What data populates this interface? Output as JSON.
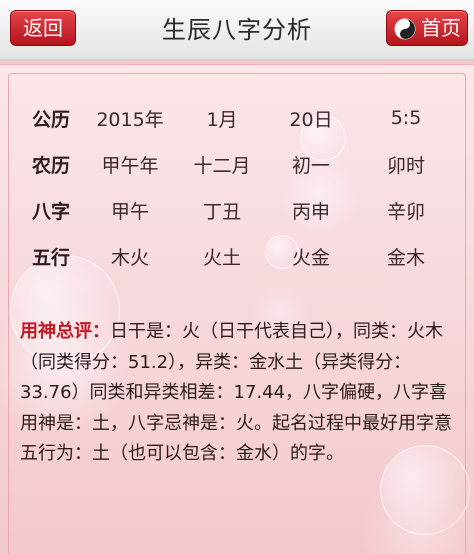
{
  "header": {
    "title": "生辰八字分析",
    "back_label": "返回",
    "home_label": "首页"
  },
  "table": {
    "rows": [
      {
        "head": "公历",
        "cells": [
          "2015年",
          "1月",
          "20日",
          "5:5"
        ]
      },
      {
        "head": "农历",
        "cells": [
          "甲午年",
          "十二月",
          "初一",
          "卯时"
        ]
      },
      {
        "head": "八字",
        "cells": [
          "甲午",
          "丁丑",
          "丙申",
          "辛卯"
        ]
      },
      {
        "head": "五行",
        "cells": [
          "木火",
          "火土",
          "火金",
          "金木"
        ]
      }
    ]
  },
  "analysis": {
    "label": "用神总评：",
    "text": "日干是：火（日干代表自己），同类：火木（同类得分：51.2），异类：金水土（异类得分：33.76）同类和异类相差：17.44，八字偏硬，八字喜用神是：土，八字忌神是：火。起名过程中最好用字意五行为：土（也可以包含：金水）的字。"
  },
  "colors": {
    "accent": "#c21a24",
    "background": "#f6d6da"
  }
}
